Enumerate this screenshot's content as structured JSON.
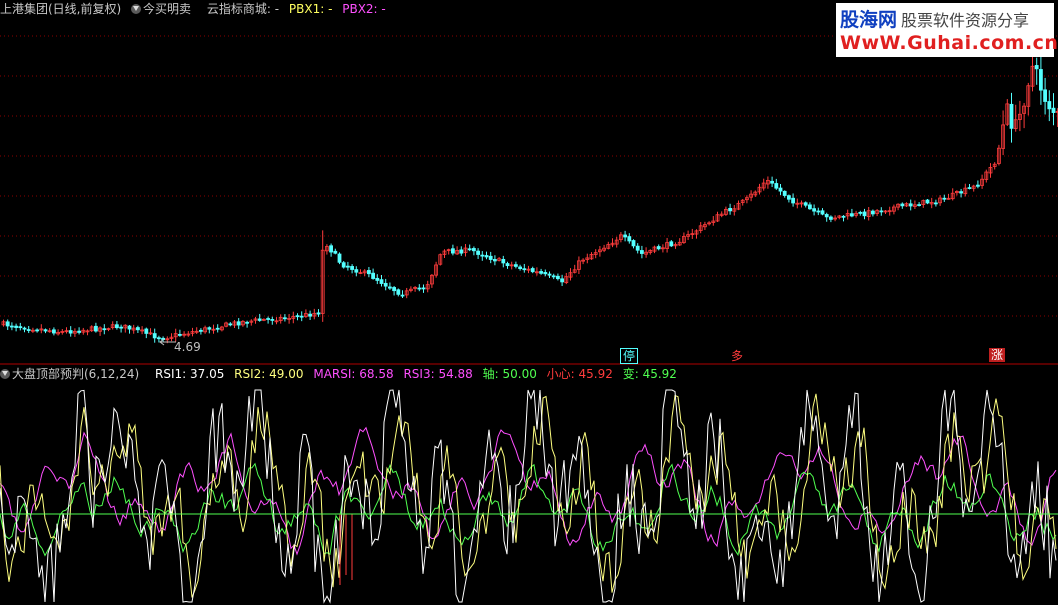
{
  "top_header": {
    "stock": "上港集团(日线,前复权)",
    "indicator1": "今买明卖",
    "indicator2": "云指标商城: -",
    "pbx1": "PBX1: -",
    "pbx2": "PBX2: -"
  },
  "logo": {
    "name": "股海网",
    "slogan": "股票软件资源分享",
    "url": "WwW.Guhai.com.cn"
  },
  "price_panel": {
    "low_label": "4.69",
    "signals": [
      "停",
      "多",
      "涨"
    ]
  },
  "indicator_header": {
    "name": "大盘顶部预判(6,12,24)",
    "rsi1": "RSI1: 37.05",
    "rsi2": "RSI2: 49.00",
    "marsi": "MARSI: 68.58",
    "rsi3": "RSI3: 54.88",
    "axis": "轴: 50.00",
    "caution": "小心: 45.92",
    "change": "变: 45.92"
  },
  "colors": {
    "up": "#ff3c3c",
    "down": "#54ffff",
    "grid": "#8b0000",
    "rsi1": "#ffffff",
    "rsi2": "#ffff80",
    "marsi": "#ff50ff",
    "rsi3": "#ff50ff",
    "axis": "#50ff50",
    "caution": "#ff3c3c",
    "change": "#50ff50"
  }
}
